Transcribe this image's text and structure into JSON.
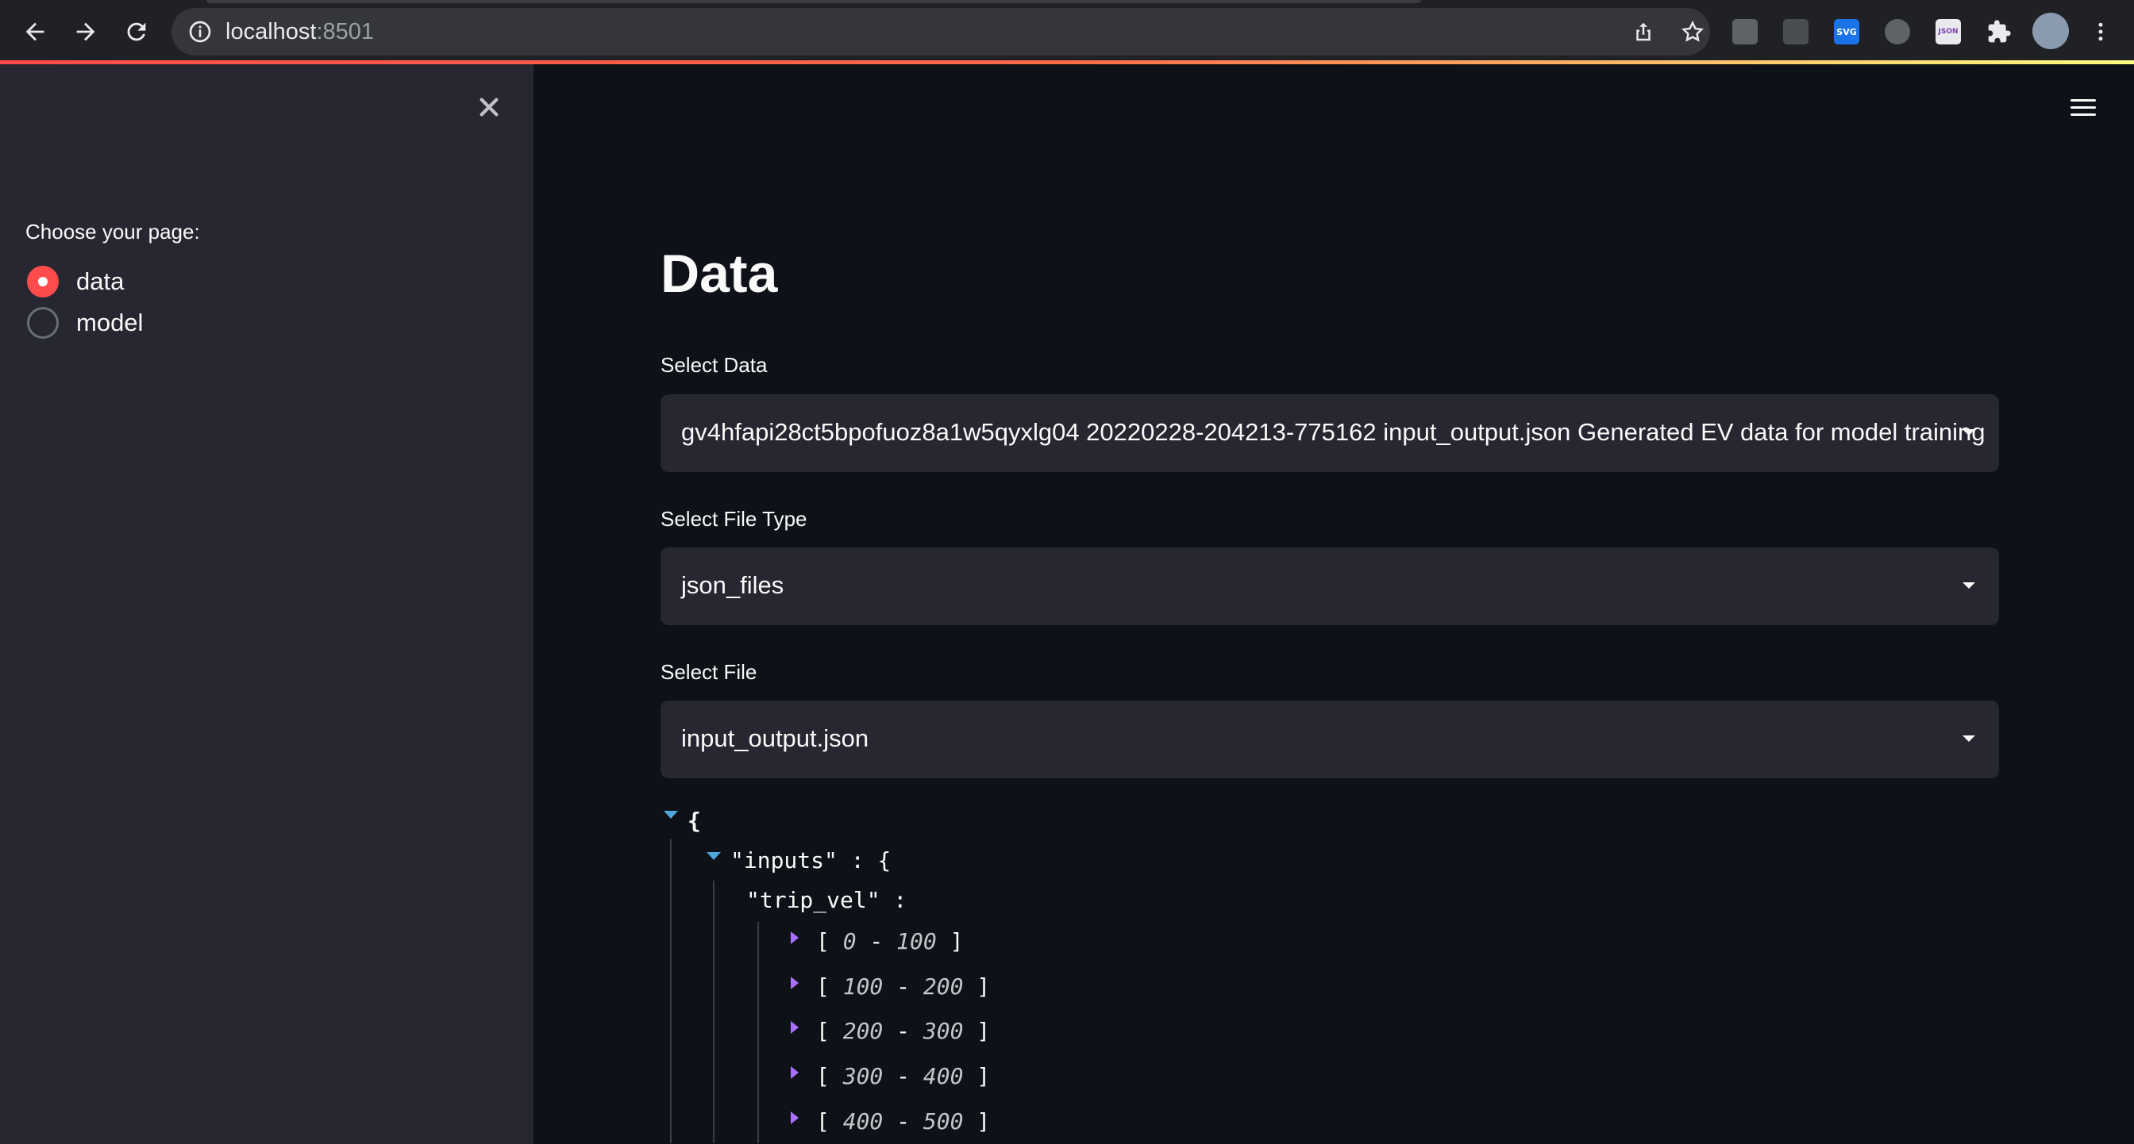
{
  "browser": {
    "url_host": "localhost",
    "url_port": ":8501",
    "extensions": [
      "ext-icon-1",
      "ext-icon-2",
      "SVG",
      "ext-icon-4",
      "JSON",
      "puzzle-icon"
    ]
  },
  "sidebar": {
    "radio_label": "Choose your page:",
    "options": [
      {
        "label": "data",
        "checked": true
      },
      {
        "label": "model",
        "checked": false
      }
    ]
  },
  "main": {
    "title": "Data",
    "select_data": {
      "label": "Select Data",
      "value": "gv4hfapi28ct5bpofuoz8a1w5qyxlg04 20220228-204213-775162 input_output.json Generated EV data for model training"
    },
    "select_file_type": {
      "label": "Select File Type",
      "value": "json_files"
    },
    "select_file": {
      "label": "Select File",
      "value": "input_output.json"
    },
    "json_view": {
      "open_brace": "{",
      "inputs_key": "\"inputs\" : {",
      "trip_vel_key": "\"trip_vel\" :",
      "ranges": [
        {
          "start": "0",
          "end": "100"
        },
        {
          "start": "100",
          "end": "200"
        },
        {
          "start": "200",
          "end": "300"
        },
        {
          "start": "300",
          "end": "400"
        },
        {
          "start": "400",
          "end": "500"
        }
      ]
    }
  },
  "colors": {
    "accent": "#ff4b4b",
    "background": "#0e1117",
    "sidebar": "#262730",
    "widget": "#262730"
  }
}
